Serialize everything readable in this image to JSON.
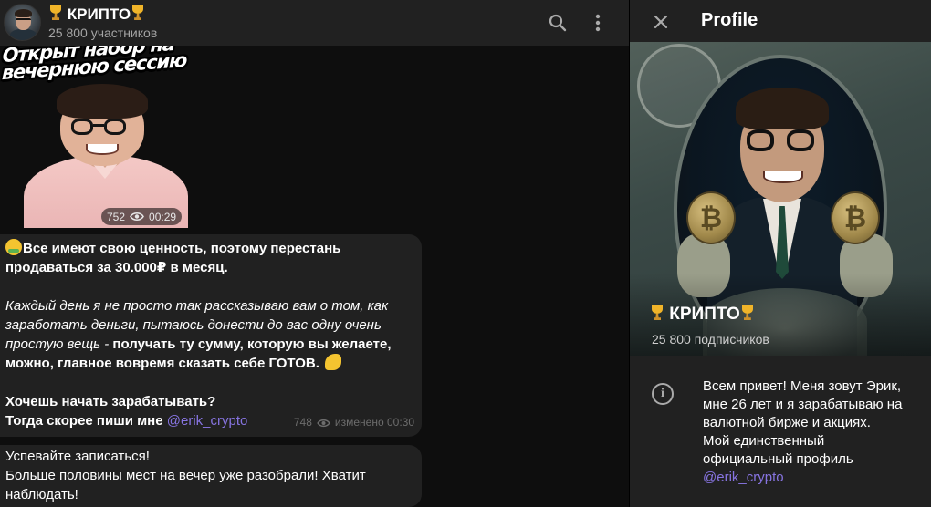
{
  "chat": {
    "title": "КРИПТО",
    "subtitle": "25 800 участников",
    "header_icons": {
      "search": "search-icon",
      "more": "more-vertical-icon"
    }
  },
  "media_message": {
    "caption_line1": "Открыт набор на",
    "caption_line2": "вечернюю сессию",
    "views": "752",
    "duration": "00:29"
  },
  "message1": {
    "line1": "Все имеют свою ценность, поэтому перестань",
    "line2": "продаваться за 30.000₽ в месяц.",
    "line3": "Каждый день я не просто так рассказываю вам о том, как",
    "line4": "заработать деньги, пытаюсь донести до вас одну очень",
    "line5_italic": "простую вещь - ",
    "line5_bold": "получать ту сумму, которую вы желаете,",
    "line6": "можно, главное вовремя сказать себе ГОТОВ.",
    "line7": "Хочешь начать зарабатывать?",
    "line8_prefix": "Тогда скорее пиши мне ",
    "line8_link": "@erik_crypto",
    "views": "748",
    "edited": "изменено 00:30"
  },
  "message2": {
    "line1": "Успевайте записаться!",
    "line2": "Больше половины мест на вечер уже разобрали! Хватит",
    "line3": "наблюдать!"
  },
  "profile": {
    "header_title": "Profile",
    "name": "КРИПТО",
    "subscribers": "25 800 подписчиков",
    "coin_symbol": "₿",
    "bio": "Всем привет! Меня зовут Эрик,\nмне 26 лет и я зарабатываю на\nвалютной бирже и акциях.\nМой единственный\nофициальный профиль",
    "bio_link": "@erik_crypto",
    "info_glyph": "i"
  },
  "colors": {
    "accent_link": "#8774e1",
    "bubble": "#212121",
    "background": "#0e0e0e"
  }
}
